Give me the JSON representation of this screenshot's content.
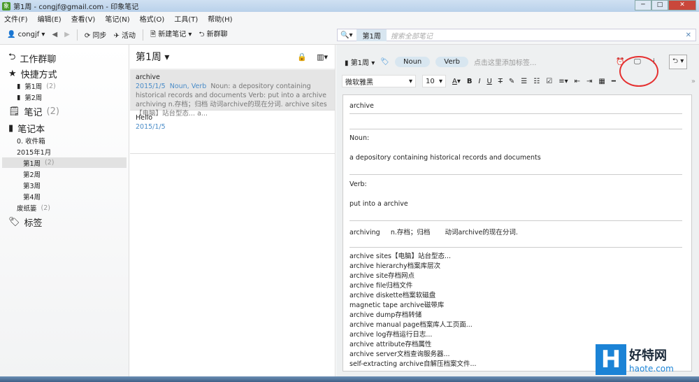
{
  "window": {
    "title": "第1周 - congjf@gmail.com - 印象笔记"
  },
  "menu": [
    "文件(F)",
    "编辑(E)",
    "查看(V)",
    "笔记(N)",
    "格式(O)",
    "工具(T)",
    "帮助(H)"
  ],
  "toolbar": {
    "user": "congjf",
    "sync": "同步",
    "activity": "活动",
    "new_note": "新建笔记",
    "new_chat": "新群聊"
  },
  "search": {
    "scope": "第1周",
    "placeholder": "搜索全部笔记"
  },
  "sidebar": {
    "work_chat": "工作群聊",
    "shortcuts": "快捷方式",
    "shortcut_items": [
      {
        "label": "第1周",
        "count": "(2)"
      },
      {
        "label": "第2周",
        "count": ""
      }
    ],
    "notes": "笔记",
    "notes_count": "(2)",
    "notebooks": "笔记本",
    "notebook_items": [
      {
        "label": "0. 收件箱",
        "count": ""
      },
      {
        "label": "2015年1月",
        "count": ""
      },
      {
        "label": "第1周",
        "count": "(2)"
      },
      {
        "label": "第2周",
        "count": ""
      },
      {
        "label": "第3周",
        "count": ""
      },
      {
        "label": "第4周",
        "count": ""
      },
      {
        "label": "废纸篓",
        "count": "(2)"
      }
    ],
    "tags": "标签"
  },
  "notelist": {
    "title": "第1周",
    "notes": [
      {
        "title": "archive",
        "date": "2015/1/5",
        "tags": "Noun, Verb",
        "snippet": "Noun: a depository containing historical records and documents Verb: put into a archive archiving n.存档；归档 动词archive的现在分词. archive sites【电脑】站台型态... a..."
      },
      {
        "title": "Hello",
        "date": "2015/1/5",
        "tags": "",
        "snippet": ""
      }
    ]
  },
  "editor": {
    "notebook": "第1周",
    "tags": [
      "Noun",
      "Verb"
    ],
    "tag_placeholder": "点击这里添加标签...",
    "font": "微软雅黑",
    "size": "10",
    "lines": {
      "title": "archive",
      "noun": "Noun:",
      "noun_def": "a depository containing historical records and documents",
      "verb": "Verb:",
      "verb_def": "put into a archive",
      "archiving": "archiving     n.存档；归档       动词archive的现在分词."
    },
    "list": [
      "archive sites【电脑】站台型态...",
      "archive hierarchy档案库层次",
      "archive site存档网点",
      "archive file归档文件",
      "archive diskette档案软磁盘",
      "magnetic tape archive磁带库",
      "archive dump存档转储",
      "archive manual page档案库人工页面...",
      "archive log存档运行日志...",
      "archive attribute存档属性",
      "archive server文档查询服务器...",
      "self-extracting archive自解压档案文件..."
    ]
  },
  "watermark": {
    "brand": "好特网",
    "site": "haote.com"
  }
}
